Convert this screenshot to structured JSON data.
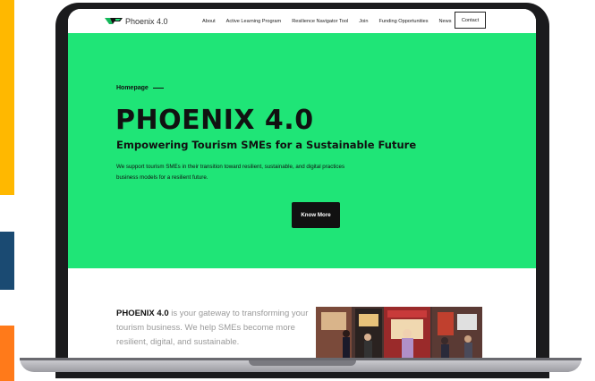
{
  "colors": {
    "hero_bg": "#1fe577",
    "accent_yellow": "#ffb800",
    "accent_navy": "#1a4a72",
    "accent_orange": "#ff7a1a",
    "button_dark": "#111111"
  },
  "nav": {
    "logo_icon": "phoenix-wing-logo",
    "logo_text": "Phoenix 4.0",
    "links": [
      "About",
      "Active Learning Program",
      "Resilience Navigator Tool",
      "Join",
      "Funding Opportunities",
      "News"
    ],
    "dot": "•",
    "contact_label": "Contact"
  },
  "hero": {
    "breadcrumb": "Homepage",
    "title": "PHOENIX 4.0",
    "subtitle": "Empowering Tourism SMEs for a Sustainable Future",
    "description": "We support tourism SMEs in their transition toward resilient, sustainable, and digital practices business models for a resilient future.",
    "cta_label": "Know More"
  },
  "intro": {
    "strong": "PHOENIX 4.0",
    "text": " is your gateway to transforming your tourism business. We help SMEs become more resilient, digital, and sustainable."
  }
}
